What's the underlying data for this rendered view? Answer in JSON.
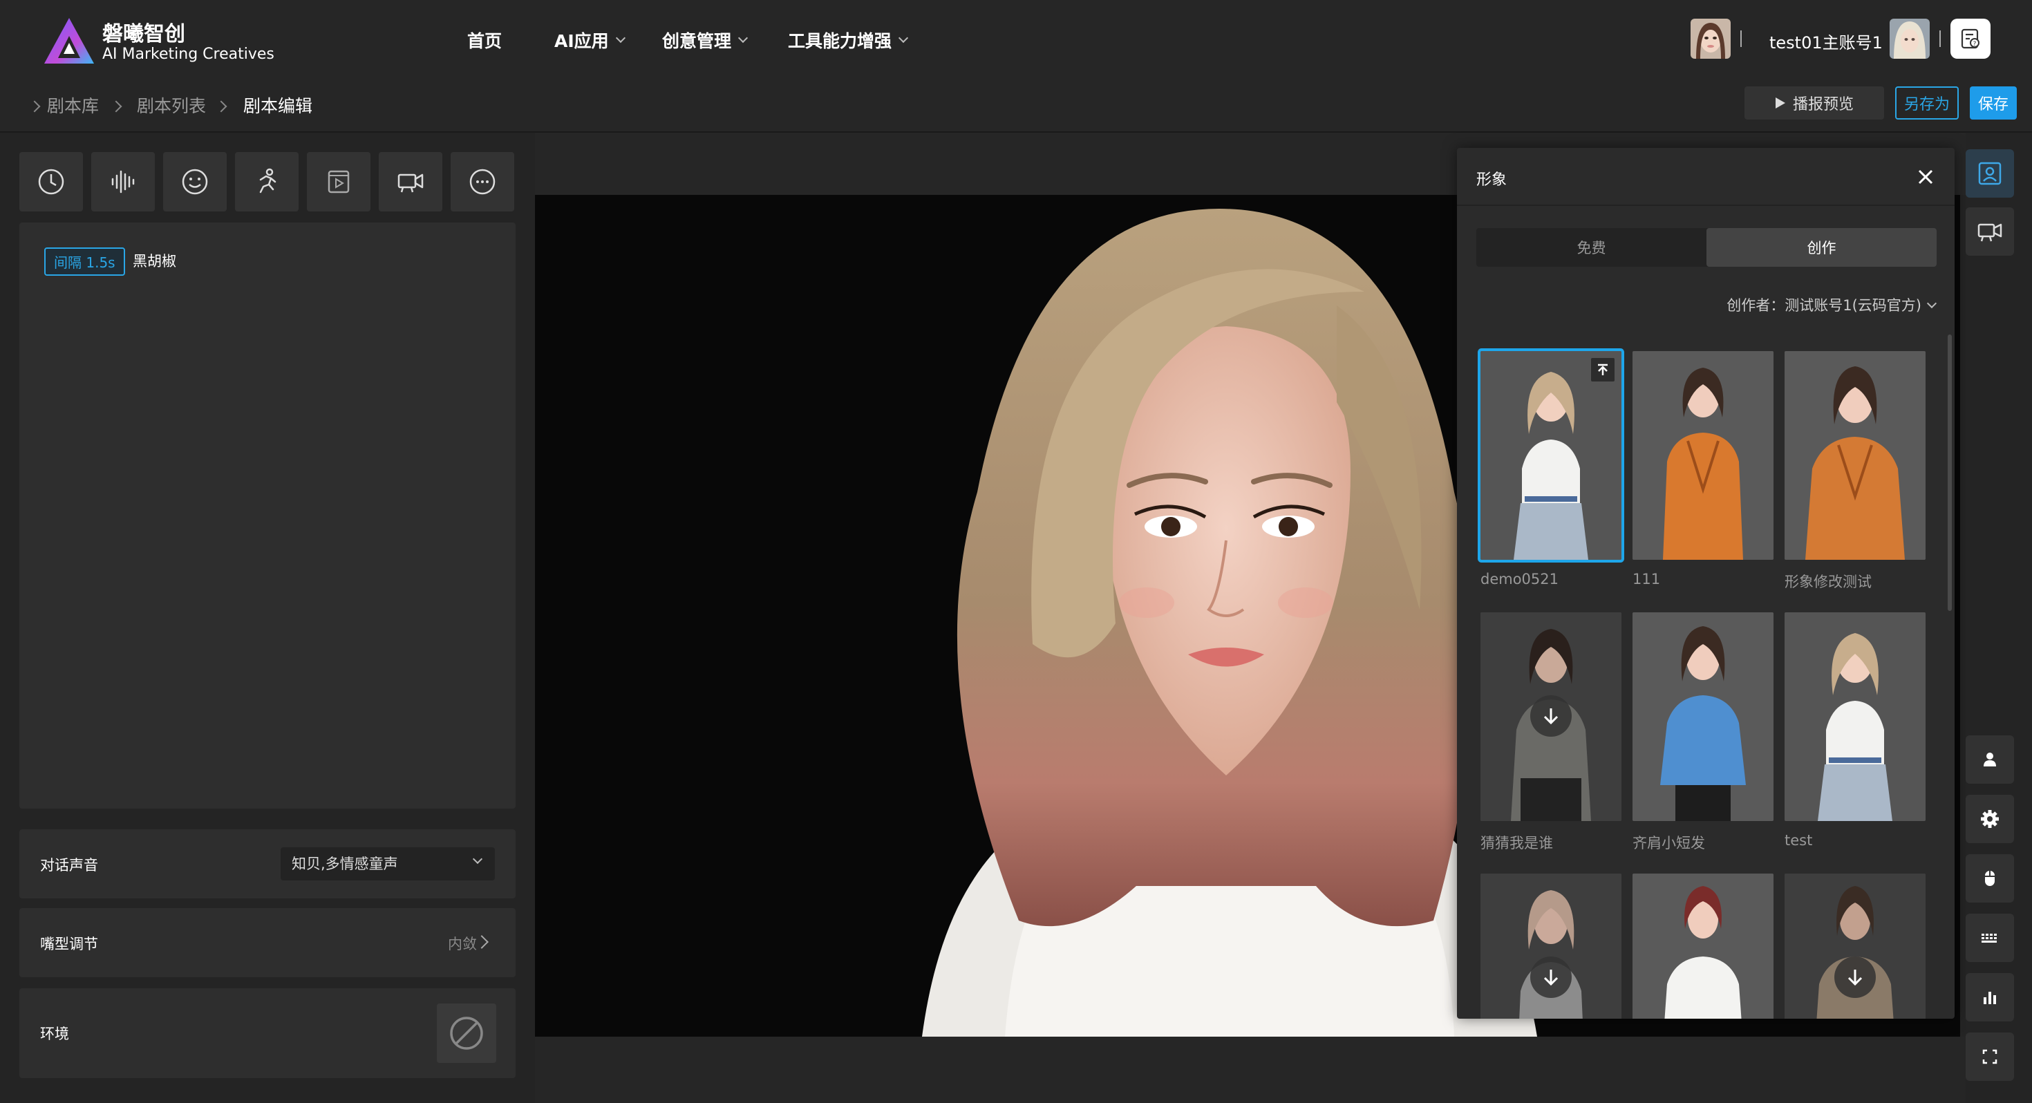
{
  "brand": {
    "name_cn": "磐曦智创",
    "name_en": "AI Marketing Creatives"
  },
  "nav": {
    "items": [
      {
        "label": "首页",
        "has_dropdown": false
      },
      {
        "label": "AI应用",
        "has_dropdown": true
      },
      {
        "label": "创意管理",
        "has_dropdown": true
      },
      {
        "label": "工具能力增强",
        "has_dropdown": true
      }
    ]
  },
  "account": {
    "name": "test01主账号1"
  },
  "breadcrumb": {
    "items": [
      "剧本库",
      "剧本列表",
      "剧本编辑"
    ]
  },
  "actions": {
    "preview_label": "播报预览",
    "saveas_label": "另存为",
    "save_label": "保存"
  },
  "toolbar": {
    "icons": [
      "clock-icon",
      "waveform-icon",
      "smile-icon",
      "running-icon",
      "video-clip-icon",
      "camera-icon",
      "more-icon"
    ]
  },
  "script": {
    "interval_tag": "间隔 1.5s",
    "text": "黑胡椒"
  },
  "settings": {
    "voice_label": "对话声音",
    "voice_value": "知贝,多情感童声",
    "mouth_label": "嘴型调节",
    "mouth_value": "内敛",
    "env_label": "环境"
  },
  "panel": {
    "title": "形象",
    "tabs": [
      "免费",
      "创作"
    ],
    "active_tab": "创作",
    "creator_label": "创作者：测试账号1(云码官方)",
    "avatars": [
      {
        "name": "demo0521",
        "selected": true,
        "badge": "upload"
      },
      {
        "name": "111",
        "badge": "none"
      },
      {
        "name": "形象修改测试",
        "badge": "none"
      },
      {
        "name": "猜猜我是谁",
        "badge": "download"
      },
      {
        "name": "齐肩小短发",
        "badge": "none"
      },
      {
        "name": "test",
        "badge": "none"
      },
      {
        "name": "",
        "badge": "download"
      },
      {
        "name": "",
        "badge": "none"
      },
      {
        "name": "",
        "badge": "download"
      }
    ]
  },
  "right_rail": {
    "top_icons": [
      "portrait-icon",
      "camera-icon"
    ],
    "bottom_icons": [
      "person-icon",
      "gear-icon",
      "mouse-icon",
      "keyboard-icon",
      "bar-chart-icon",
      "fullscreen-icon"
    ]
  },
  "colors": {
    "accent": "#1ea6ea",
    "background": "#242424",
    "panel": "#2b2b2b"
  }
}
